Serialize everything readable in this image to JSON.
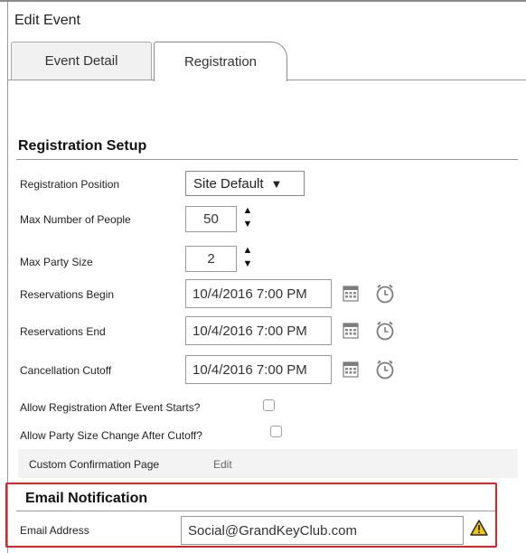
{
  "window": {
    "title": "Edit Event"
  },
  "tabs": [
    {
      "label": "Event Detail"
    },
    {
      "label": "Registration"
    }
  ],
  "registration_setup": {
    "heading": "Registration Setup",
    "position": {
      "label": "Registration Position",
      "value": "Site Default",
      "arrow": "▼"
    },
    "max_people": {
      "label": "Max Number of People",
      "value": "50"
    },
    "max_party": {
      "label": "Max Party Size",
      "value": "2"
    },
    "res_begin": {
      "label": "Reservations Begin",
      "value": "10/4/2016 7:00 PM"
    },
    "res_end": {
      "label": "Reservations End",
      "value": "10/4/2016 7:00 PM"
    },
    "cancel_cutoff": {
      "label": "Cancellation Cutoff",
      "value": "10/4/2016 7:00 PM"
    },
    "allow_after_start": {
      "label": "Allow Registration After Event Starts?",
      "checked": false
    },
    "allow_party_change": {
      "label": "Allow Party Size Change After Cutoff?",
      "checked": false
    },
    "custom_confirmation": {
      "label": "Custom Confirmation Page",
      "edit_label": "Edit"
    }
  },
  "email_notification": {
    "heading": "Email Notification",
    "email": {
      "label": "Email Address",
      "value": "Social@GrandKeyClub.com"
    }
  },
  "icons": {
    "calendar": "calendar-icon",
    "clock": "clock-icon",
    "warning": "warning-icon",
    "spinner_up": "▲",
    "spinner_down": "▼"
  },
  "colors": {
    "highlight": "#d9232a",
    "warning": "#f5c400"
  }
}
